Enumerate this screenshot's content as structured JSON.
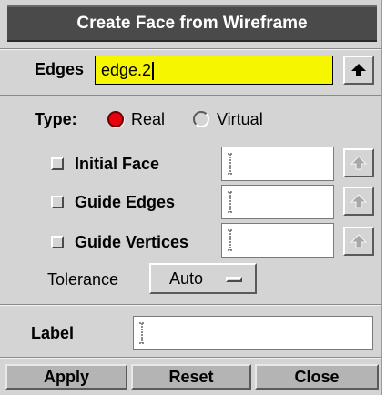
{
  "dialog": {
    "title": "Create Face from Wireframe"
  },
  "edges": {
    "label": "Edges",
    "value": "edge.2"
  },
  "type": {
    "label": "Type:",
    "options": [
      "Real",
      "Virtual"
    ],
    "selected": "Real"
  },
  "rows": [
    {
      "label": "Initial Face",
      "checked": false,
      "value": ""
    },
    {
      "label": "Guide Edges",
      "checked": false,
      "value": ""
    },
    {
      "label": "Guide Vertices",
      "checked": false,
      "value": ""
    }
  ],
  "tolerance": {
    "label": "Tolerance",
    "value": "Auto"
  },
  "label_field": {
    "label": "Label",
    "value": ""
  },
  "buttons": {
    "apply": "Apply",
    "reset": "Reset",
    "close": "Close"
  },
  "colors": {
    "highlight": "#f6f600",
    "radio_on": "#e8000e",
    "title_bg": "#4a4a4a"
  }
}
